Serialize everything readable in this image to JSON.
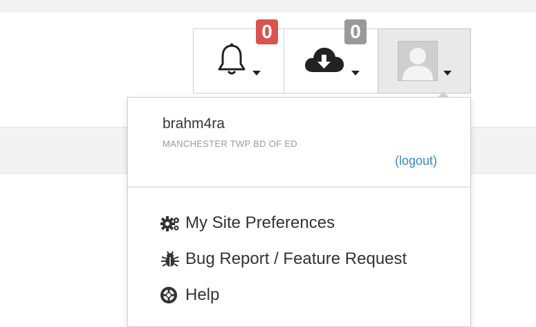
{
  "header": {
    "notifications": {
      "count": "0",
      "icon": "bell-icon"
    },
    "downloads": {
      "count": "0",
      "icon": "cloud-download-icon"
    },
    "user_menu": {
      "icon": "user-avatar-icon"
    }
  },
  "dropdown": {
    "username": "brahm4ra",
    "organization": "MANCHESTER TWP BD OF ED",
    "logout_label": "(logout)",
    "items": [
      {
        "label": "My Site Preferences",
        "icon": "gears-icon"
      },
      {
        "label": "Bug Report / Feature Request",
        "icon": "bug-icon"
      },
      {
        "label": "Help",
        "icon": "lifebuoy-icon"
      }
    ]
  },
  "colors": {
    "badge_alert": "#d9534f",
    "badge_neutral": "#999999",
    "link": "#3a87c8"
  }
}
